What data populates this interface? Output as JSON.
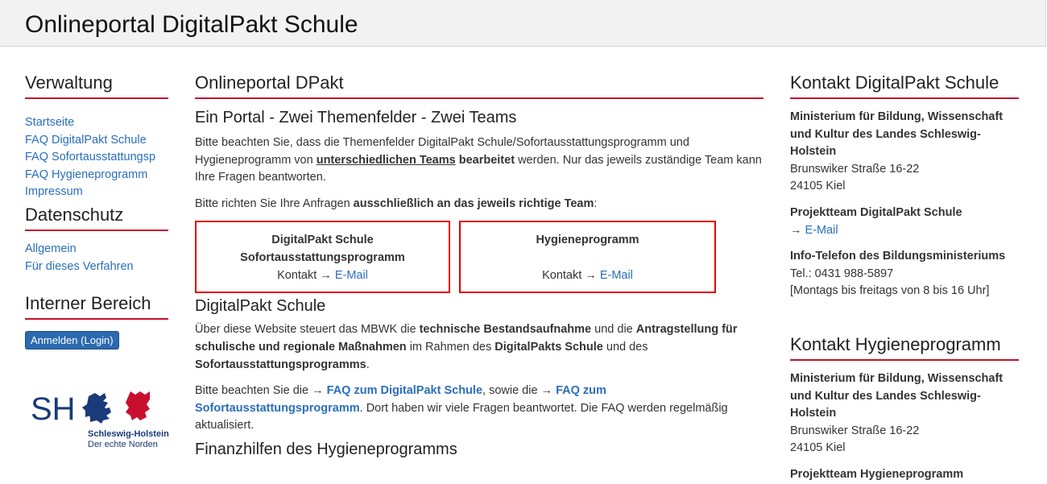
{
  "header": {
    "title": "Onlineportal DigitalPakt Schule"
  },
  "sidebar": {
    "verwaltung_title": "Verwaltung",
    "verwaltung_items": [
      "Startseite",
      "FAQ DigitalPakt Schule",
      "FAQ Sofortausstattungsp",
      "FAQ Hygieneprogramm",
      "Impressum"
    ],
    "datenschutz_title": "Datenschutz",
    "datenschutz_items": [
      "Allgemein",
      "Für dieses Verfahren"
    ],
    "intern_title": "Interner Bereich",
    "login_label": "Anmelden (Login)",
    "logo": {
      "letters": "SH",
      "line1": "Schleswig-Holstein",
      "line2": "Der echte Norden"
    }
  },
  "main": {
    "title": "Onlineportal DPakt",
    "subtitle": "Ein Portal - Zwei Themenfelder - Zwei Teams",
    "p1_a": "Bitte beachten Sie, dass die Themenfelder DigitalPakt Schule/Sofortausstattungsprogramm und Hygieneprogramm von ",
    "p1_b": "unterschiedlichen Teams",
    "p1_c": " bearbeitet",
    "p1_d": " werden. Nur das jeweils zuständige Team kann Ihre Fragen beantworten.",
    "p2_a": "Bitte richten Sie Ihre Anfragen ",
    "p2_b": "ausschließlich an das jeweils richtige Team",
    "p2_c": ":",
    "box1": {
      "line1": "DigitalPakt Schule",
      "line2": "Sofortausstattungsprogramm",
      "contact": "Kontakt → ",
      "link": "E-Mail"
    },
    "box2": {
      "line1": "Hygieneprogramm",
      "contact": "Kontakt → ",
      "link": "E-Mail"
    },
    "h_digitalpakt": "DigitalPakt Schule",
    "p3_a": "Über diese Website steuert das MBWK die ",
    "p3_b": "technische Bestandsaufnahme",
    "p3_c": " und die ",
    "p3_d": "Antragstellung für schulische und regionale Maßnahmen",
    "p3_e": " im Rahmen des ",
    "p3_f": "DigitalPakts Schule",
    "p3_g": " und des ",
    "p3_h": "Sofortausstattungsprogramms",
    "p3_i": ".",
    "p4_a": "Bitte beachten Sie die → ",
    "p4_link1": "FAQ zum DigitalPakt Schule",
    "p4_b": ", sowie die → ",
    "p4_link2": "FAQ zum Sofortausstattungsprogramm",
    "p4_c": ". Dort haben wir viele Fragen beantwortet. Die FAQ werden regelmäßig aktualisiert.",
    "h_finanz": "Finanzhilfen des Hygieneprogramms"
  },
  "right": {
    "kontakt1_title": "Kontakt DigitalPakt Schule",
    "ministry": "Ministerium für Bildung, Wissenschaft und Kultur des Landes Schleswig-Holstein",
    "street": "Brunswiker Straße 16-22",
    "city": "24105 Kiel",
    "projektteam1": "Projektteam DigitalPakt Schule",
    "arrow": "→ ",
    "email": "E-Mail",
    "info_title": "Info-Telefon des Bildungsministeriums",
    "tel": "Tel.: 0431 988-5897",
    "hours": "[Montags bis freitags von 8 bis 16 Uhr]",
    "kontakt2_title": "Kontakt Hygieneprogramm",
    "ministry2": "Ministerium für Bildung, Wissenschaft und Kultur des Landes Schleswig-Holstein",
    "street2": "Brunswiker Straße 16-22",
    "city2": "24105 Kiel",
    "projektteam2": "Projektteam Hygieneprogramm"
  },
  "colors": {
    "accent": "#c8102e",
    "link": "#2a6ebb",
    "box_border": "#e00000",
    "button": "#2c6ab0"
  }
}
